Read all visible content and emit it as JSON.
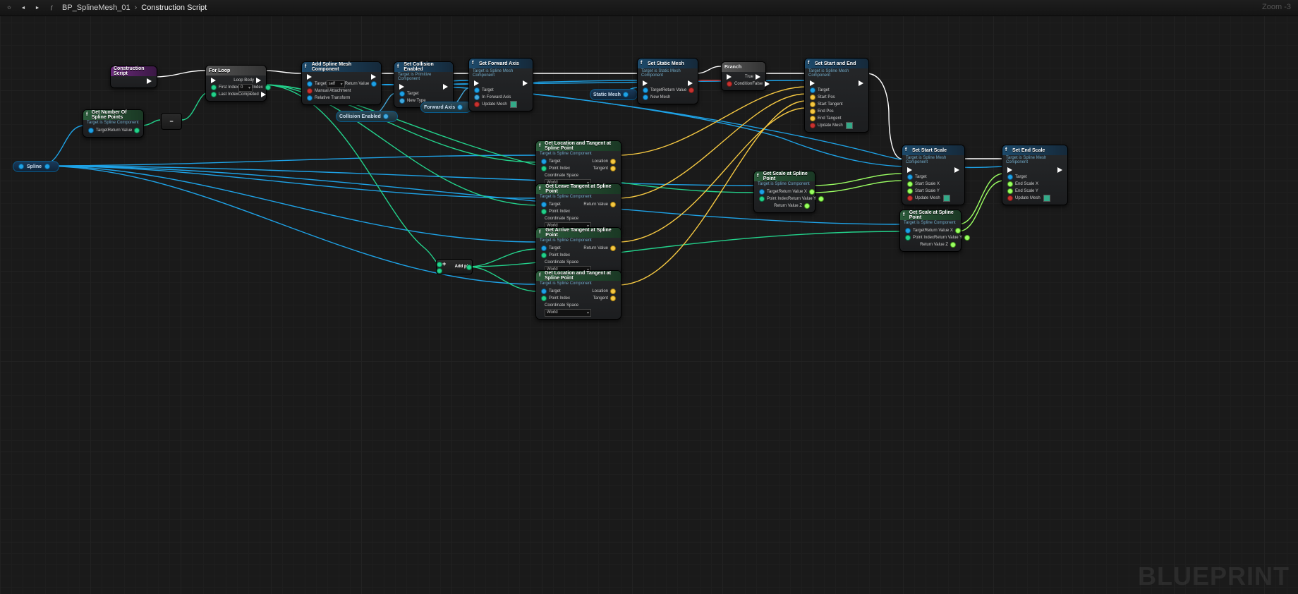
{
  "toolbar": {
    "bookmark": "★",
    "back": "◄",
    "fwd": "►",
    "fn": "f",
    "crumb1": "BP_SplineMesh_01",
    "crumb2": "Construction Script"
  },
  "zoom": "Zoom  -3",
  "watermark": "BLUEPRINT",
  "varSpline": "Spline",
  "staticMesh": "Static Mesh",
  "collisionEnabled": "Collision Enabled",
  "forwardAxis": "Forward Axis",
  "addPin": "Add pin",
  "nodes": {
    "cs": {
      "title": "Construction Script"
    },
    "getNumPts": {
      "title": "Get Number Of Spline Points",
      "sub": "Target is Spline Component",
      "target": "Target",
      "ret": "Return Value"
    },
    "forLoop": {
      "title": "For Loop",
      "loopBody": "Loop Body",
      "first": "First Index",
      "last": "Last Index",
      "index": "Index",
      "completed": "Completed",
      "firstVal": "0"
    },
    "addSMC": {
      "title": "Add Spline Mesh Component",
      "target": "Target",
      "self": "self",
      "manual": "Manual Attachment",
      "relative": "Relative Transform",
      "ret": "Return Value"
    },
    "setColl": {
      "title": "Set Collision Enabled",
      "sub": "Target is Primitive Component",
      "target": "Target",
      "newType": "New Type"
    },
    "setFA": {
      "title": "Set Forward Axis",
      "sub": "Target is Spline Mesh Component",
      "target": "Target",
      "inFA": "In Forward Axis",
      "update": "Update Mesh"
    },
    "setSM": {
      "title": "Set Static Mesh",
      "sub": "Target is Static Mesh Component",
      "target": "Target",
      "newMesh": "New Mesh",
      "ret": "Return Value"
    },
    "branch": {
      "title": "Branch",
      "cond": "Condition",
      "true": "True",
      "false": "False"
    },
    "setSE": {
      "title": "Set Start and End",
      "sub": "Target is Spline Mesh Component",
      "target": "Target",
      "startPos": "Start Pos",
      "startTan": "Start Tangent",
      "endPos": "End Pos",
      "endTan": "End Tangent",
      "update": "Update Mesh"
    },
    "getLT": {
      "title": "Get Location and Tangent at Spline Point",
      "sub": "Target is Spline Component",
      "target": "Target",
      "pidx": "Point Index",
      "cs": "Coordinate Space",
      "csval": "World",
      "loc": "Location",
      "tan": "Tangent"
    },
    "getLeave": {
      "title": "Get Leave Tangent at Spline Point",
      "sub": "Target is Spline Component",
      "target": "Target",
      "pidx": "Point Index",
      "cs": "Coordinate Space",
      "csval": "World",
      "ret": "Return Value"
    },
    "getArrive": {
      "title": "Get Arrive Tangent at Spline Point",
      "sub": "Target is Spline Component",
      "target": "Target",
      "pidx": "Point Index",
      "cs": "Coordinate Space",
      "csval": "World",
      "ret": "Return Value"
    },
    "getScale": {
      "title": "Get Scale at Spline Point",
      "sub": "Target is Spline Component",
      "target": "Target",
      "pidx": "Point Index",
      "rvx": "Return Value X",
      "rvy": "Return Value Y",
      "rvz": "Return Value Z"
    },
    "setSS": {
      "title": "Set Start Scale",
      "sub": "Target is Spline Mesh Component",
      "target": "Target",
      "ssx": "Start Scale X",
      "ssy": "Start Scale Y",
      "update": "Update Mesh"
    },
    "setES": {
      "title": "Set End Scale",
      "sub": "Target is Spline Mesh Component",
      "target": "Target",
      "esx": "End Scale X",
      "esy": "End Scale Y",
      "update": "Update Mesh"
    }
  }
}
